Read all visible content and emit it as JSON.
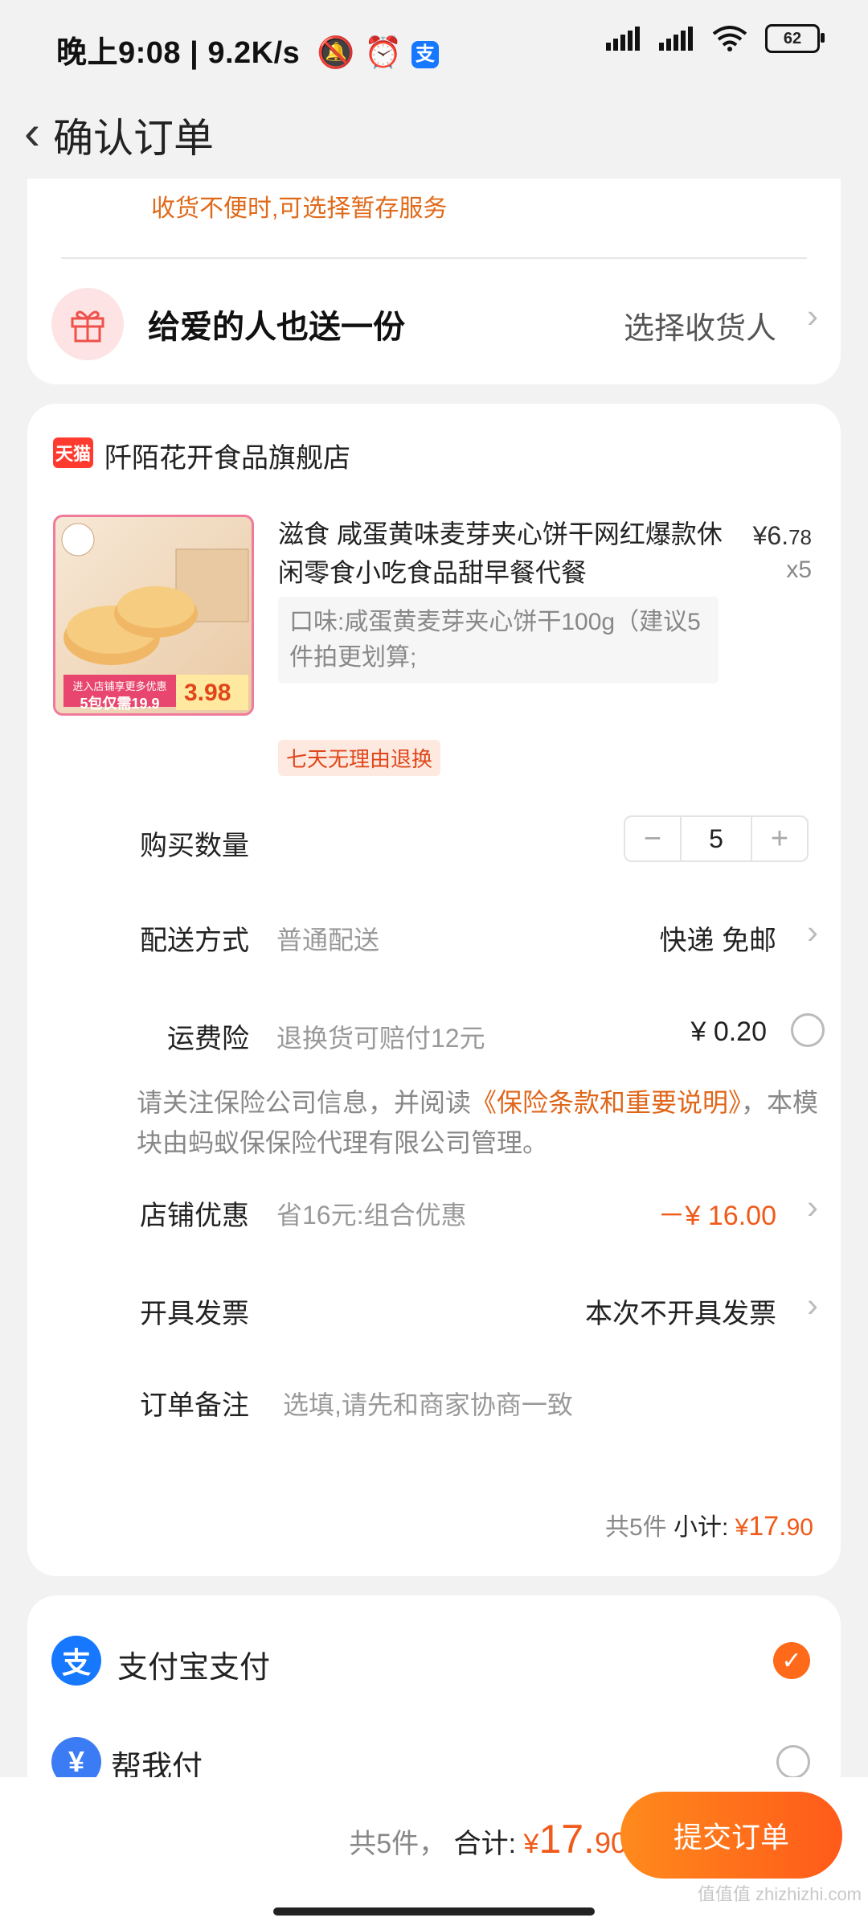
{
  "status_bar": {
    "time": "晚上9:08",
    "speed": "9.2K/s",
    "battery": "62",
    "icons": [
      "mute-icon",
      "alarm-icon",
      "alipay-icon",
      "signal-icon",
      "hd-signal-icon",
      "wifi-icon",
      "battery-icon"
    ]
  },
  "header": {
    "title": "确认订单"
  },
  "notice": "收货不便时,可选择暂存服务",
  "gift": {
    "title": "给爱的人也送一份",
    "action": "选择收货人"
  },
  "store": {
    "badge": "天猫",
    "name": "阡陌花开食品旗舰店"
  },
  "product": {
    "title": "滋食 咸蛋黄味麦芽夹心饼干网红爆款休闲零食小吃食品甜早餐代餐",
    "price_int": "¥6.",
    "price_dec": "78",
    "qty": "x5",
    "spec": "口味:咸蛋黄麦芽夹心饼干100g（建议5件拍更划算;",
    "tag": "七天无理由退换",
    "thumb_text1": "进入店铺享更多优惠",
    "thumb_text2": "5包仅需19.9",
    "thumb_price": "3.98"
  },
  "rows": {
    "qty_label": "购买数量",
    "qty_value": "5",
    "minus": "−",
    "plus": "+",
    "ship_label": "配送方式",
    "ship_sub": "普通配送",
    "ship_value": "快递 免邮",
    "ins_label": "运费险",
    "ins_sub": "退换货可赔付12元",
    "ins_value": "¥ 0.20",
    "ins_note_1": "请关注保险公司信息，并阅读",
    "ins_note_link": "《保险条款和重要说明》",
    "ins_note_2": "，本模块由蚂蚁保保险代理有限公司管理。",
    "disc_label": "店铺优惠",
    "disc_sub": "省16元:组合优惠",
    "disc_value": "－¥ 16.00",
    "inv_label": "开具发票",
    "inv_value": "本次不开具发票",
    "note_label": "订单备注",
    "note_placeholder": "选填,请先和商家协商一致"
  },
  "subtotal": {
    "count": "共5件",
    "label": "小计:",
    "cur": "¥",
    "int": "17.",
    "dec": "90"
  },
  "payment": {
    "alipay": "支付宝支付",
    "helppay": "帮我付"
  },
  "bottom": {
    "count": "共5件，",
    "label": "合计:",
    "cur": "¥",
    "int": "17.",
    "dec": "90",
    "submit": "提交订单",
    "watermark": "值值值 zhizhizhi.com"
  }
}
